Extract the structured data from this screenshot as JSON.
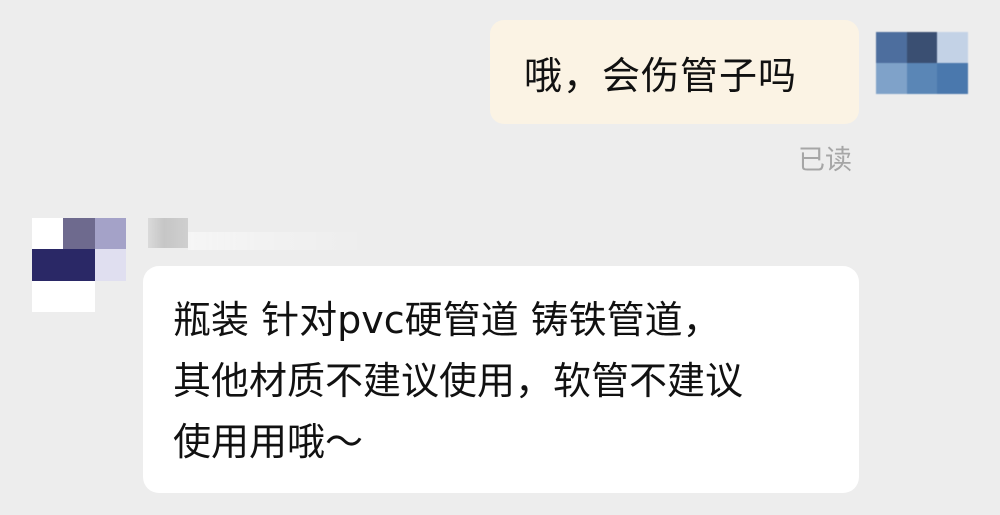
{
  "conversation": {
    "outgoing": {
      "text": "哦，会伤管子吗",
      "status": "已读"
    },
    "incoming": {
      "lines": [
        "瓶装 针对pvc硬管道 铸铁管道，",
        "其他材质不建议使用，软管不建议",
        "使用用哦～"
      ]
    }
  },
  "avatars": {
    "self_colors": [
      "#4d6e9e",
      "#3a4f72",
      "#c3d2e6",
      "#7fa2c9",
      "#5a86b6",
      "#4a78ad"
    ],
    "contact_colors": [
      "#ffffff",
      "#6e6a8e",
      "#a4a2c8",
      "#2a2866",
      "#2a2866",
      "#e0dff0",
      "#ffffff",
      "#ffffff",
      "#ededed"
    ]
  }
}
